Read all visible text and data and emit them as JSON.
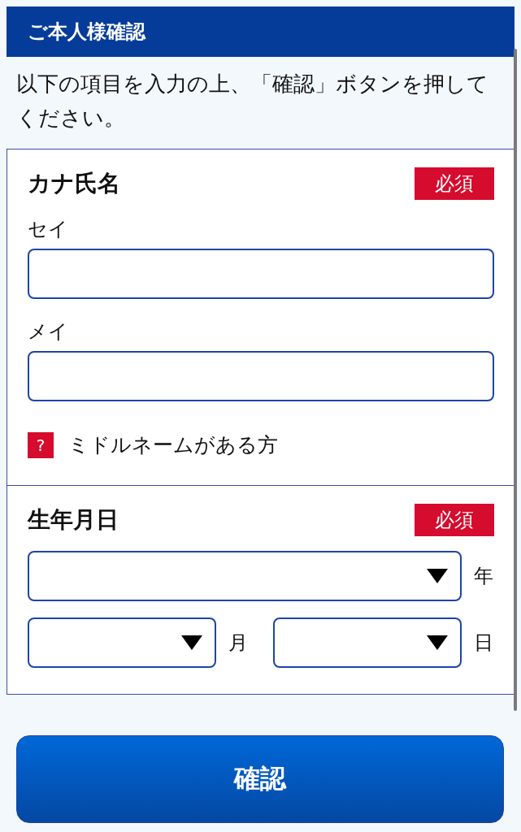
{
  "header": {
    "title": "ご本人様確認"
  },
  "instructions": "以下の項目を入力の上、「確認」ボタンを押してください。",
  "sections": [
    {
      "kind": "name",
      "title": "カナ氏名",
      "badge": "必須",
      "fields": [
        {
          "label": "セイ"
        },
        {
          "label": "メイ"
        }
      ],
      "help": {
        "icon": "?",
        "text": "ミドルネームがある方"
      }
    },
    {
      "kind": "date",
      "title": "生年月日",
      "badge": "必須",
      "selects": [
        {
          "unit": "年"
        },
        {
          "unit": "月"
        },
        {
          "unit": "日"
        }
      ]
    }
  ],
  "submit": "確認"
}
